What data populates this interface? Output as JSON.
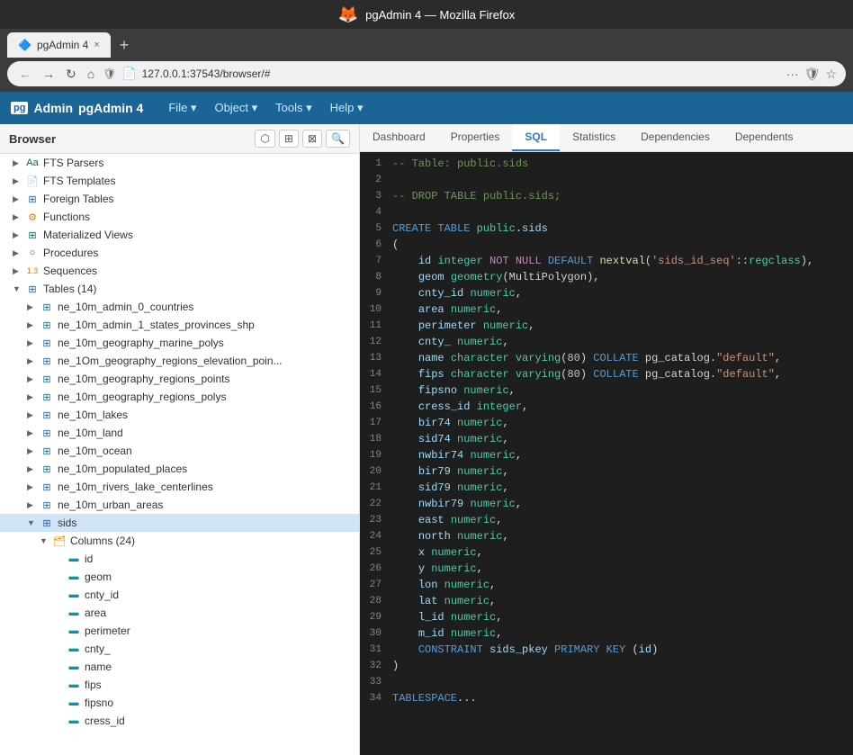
{
  "window": {
    "title": "pgAdmin 4 — Mozilla Firefox",
    "tab_label": "pgAdmin 4",
    "tab_close": "×",
    "tab_new": "+",
    "address": "127.0.0.1:37543/browser/#",
    "address_prefix": "🔒",
    "nav_back": "←",
    "nav_forward": "→",
    "nav_refresh": "↻",
    "nav_home": "⌂"
  },
  "pgadmin": {
    "logo_pg": "pg",
    "logo_admin": "Admin",
    "app_name": "pgAdmin 4",
    "menus": [
      {
        "label": "File ▾"
      },
      {
        "label": "Object ▾"
      },
      {
        "label": "Tools ▾"
      },
      {
        "label": "Help ▾"
      }
    ]
  },
  "browser": {
    "title": "Browser",
    "tools": [
      "⬡",
      "⊞",
      "⊠",
      "🔍"
    ]
  },
  "tree": {
    "items": [
      {
        "indent": 1,
        "arrow": "▶",
        "icon": "Aa",
        "icon_class": "icon-teal",
        "label": "FTS Parsers"
      },
      {
        "indent": 1,
        "arrow": "▶",
        "icon": "📄",
        "icon_class": "icon-orange",
        "label": "FTS Templates"
      },
      {
        "indent": 1,
        "arrow": "▶",
        "icon": "⊞",
        "icon_class": "icon-blue",
        "label": "Foreign Tables"
      },
      {
        "indent": 1,
        "arrow": "▶",
        "icon": "⚙",
        "icon_class": "icon-orange",
        "label": "Functions"
      },
      {
        "indent": 1,
        "arrow": "▶",
        "icon": "⊞",
        "icon_class": "icon-teal",
        "label": "Materialized Views"
      },
      {
        "indent": 1,
        "arrow": "▶",
        "icon": "○",
        "icon_class": "icon-purple",
        "label": "Procedures"
      },
      {
        "indent": 1,
        "arrow": "▶",
        "icon": "1.3",
        "icon_class": "icon-orange",
        "label": "Sequences"
      },
      {
        "indent": 1,
        "arrow": "▼",
        "icon": "⊞",
        "icon_class": "icon-blue",
        "label": "Tables (14)"
      },
      {
        "indent": 2,
        "arrow": "▶",
        "icon": "⊞",
        "icon_class": "icon-blue",
        "label": "ne_10m_admin_0_countries"
      },
      {
        "indent": 2,
        "arrow": "▶",
        "icon": "⊞",
        "icon_class": "icon-blue",
        "label": "ne_10m_admin_1_states_provinces_shp"
      },
      {
        "indent": 2,
        "arrow": "▶",
        "icon": "⊞",
        "icon_class": "icon-blue",
        "label": "ne_10m_geography_marine_polys"
      },
      {
        "indent": 2,
        "arrow": "▶",
        "icon": "⊞",
        "icon_class": "icon-blue",
        "label": "ne_10m_geography_regions_elevation_poin..."
      },
      {
        "indent": 2,
        "arrow": "▶",
        "icon": "⊞",
        "icon_class": "icon-blue",
        "label": "ne_10m_geography_regions_points"
      },
      {
        "indent": 2,
        "arrow": "▶",
        "icon": "⊞",
        "icon_class": "icon-blue",
        "label": "ne_10m_geography_regions_polys"
      },
      {
        "indent": 2,
        "arrow": "▶",
        "icon": "⊞",
        "icon_class": "icon-blue",
        "label": "ne_10m_lakes"
      },
      {
        "indent": 2,
        "arrow": "▶",
        "icon": "⊞",
        "icon_class": "icon-blue",
        "label": "ne_10m_land"
      },
      {
        "indent": 2,
        "arrow": "▶",
        "icon": "⊞",
        "icon_class": "icon-blue",
        "label": "ne_10m_ocean"
      },
      {
        "indent": 2,
        "arrow": "▶",
        "icon": "⊞",
        "icon_class": "icon-blue",
        "label": "ne_10m_populated_places"
      },
      {
        "indent": 2,
        "arrow": "▶",
        "icon": "⊞",
        "icon_class": "icon-blue",
        "label": "ne_10m_rivers_lake_centerlines"
      },
      {
        "indent": 2,
        "arrow": "▶",
        "icon": "⊞",
        "icon_class": "icon-blue",
        "label": "ne_10m_urban_areas"
      },
      {
        "indent": 2,
        "arrow": "▼",
        "icon": "⊞",
        "icon_class": "icon-blue",
        "label": "sids",
        "selected": true
      },
      {
        "indent": 3,
        "arrow": "▼",
        "icon": "🗂",
        "icon_class": "icon-orange",
        "label": "Columns (24)"
      },
      {
        "indent": 4,
        "arrow": "",
        "icon": "▬",
        "icon_class": "icon-cyan",
        "label": "id"
      },
      {
        "indent": 4,
        "arrow": "",
        "icon": "▬",
        "icon_class": "icon-cyan",
        "label": "geom"
      },
      {
        "indent": 4,
        "arrow": "",
        "icon": "▬",
        "icon_class": "icon-cyan",
        "label": "cnty_id"
      },
      {
        "indent": 4,
        "arrow": "",
        "icon": "▬",
        "icon_class": "icon-cyan",
        "label": "area"
      },
      {
        "indent": 4,
        "arrow": "",
        "icon": "▬",
        "icon_class": "icon-cyan",
        "label": "perimeter"
      },
      {
        "indent": 4,
        "arrow": "",
        "icon": "▬",
        "icon_class": "icon-cyan",
        "label": "cnty_"
      },
      {
        "indent": 4,
        "arrow": "",
        "icon": "▬",
        "icon_class": "icon-cyan",
        "label": "name"
      },
      {
        "indent": 4,
        "arrow": "",
        "icon": "▬",
        "icon_class": "icon-cyan",
        "label": "fips"
      },
      {
        "indent": 4,
        "arrow": "",
        "icon": "▬",
        "icon_class": "icon-cyan",
        "label": "fipsno"
      },
      {
        "indent": 4,
        "arrow": "",
        "icon": "▬",
        "icon_class": "icon-cyan",
        "label": "cress_id"
      }
    ]
  },
  "tabs": [
    {
      "label": "Dashboard"
    },
    {
      "label": "Properties"
    },
    {
      "label": "SQL",
      "active": true
    },
    {
      "label": "Statistics"
    },
    {
      "label": "Dependencies"
    },
    {
      "label": "Dependents"
    }
  ],
  "sql": {
    "lines": [
      {
        "num": 1,
        "code": "-- Table: public.sids",
        "type": "comment"
      },
      {
        "num": 2,
        "code": "",
        "type": "blank"
      },
      {
        "num": 3,
        "code": "-- DROP TABLE public.sids;",
        "type": "comment"
      },
      {
        "num": 4,
        "code": "",
        "type": "blank"
      },
      {
        "num": 5,
        "code": "CREATE TABLE public.sids",
        "type": "create_table"
      },
      {
        "num": 6,
        "code": "(",
        "type": "punc"
      },
      {
        "num": 7,
        "code": "    id integer NOT NULL DEFAULT nextval('sids_id_seq'::regclass),",
        "type": "col_def"
      },
      {
        "num": 8,
        "code": "    geom geometry(MultiPolygon),",
        "type": "col_def"
      },
      {
        "num": 9,
        "code": "    cnty_id numeric,",
        "type": "col_def"
      },
      {
        "num": 10,
        "code": "    area numeric,",
        "type": "col_def"
      },
      {
        "num": 11,
        "code": "    perimeter numeric,",
        "type": "col_def"
      },
      {
        "num": 12,
        "code": "    cnty_ numeric,",
        "type": "col_def"
      },
      {
        "num": 13,
        "code": "    name character varying(80) COLLATE pg_catalog.\"default\",",
        "type": "col_def"
      },
      {
        "num": 14,
        "code": "    fips character varying(80) COLLATE pg_catalog.\"default\",",
        "type": "col_def"
      },
      {
        "num": 15,
        "code": "    fipsno numeric,",
        "type": "col_def"
      },
      {
        "num": 16,
        "code": "    cress_id integer,",
        "type": "col_def"
      },
      {
        "num": 17,
        "code": "    bir74 numeric,",
        "type": "col_def"
      },
      {
        "num": 18,
        "code": "    sid74 numeric,",
        "type": "col_def"
      },
      {
        "num": 19,
        "code": "    nwbir74 numeric,",
        "type": "col_def"
      },
      {
        "num": 20,
        "code": "    bir79 numeric,",
        "type": "col_def"
      },
      {
        "num": 21,
        "code": "    sid79 numeric,",
        "type": "col_def"
      },
      {
        "num": 22,
        "code": "    nwbir79 numeric,",
        "type": "col_def"
      },
      {
        "num": 23,
        "code": "    east numeric,",
        "type": "col_def"
      },
      {
        "num": 24,
        "code": "    north numeric,",
        "type": "col_def"
      },
      {
        "num": 25,
        "code": "    x numeric,",
        "type": "col_def"
      },
      {
        "num": 26,
        "code": "    y numeric,",
        "type": "col_def"
      },
      {
        "num": 27,
        "code": "    lon numeric,",
        "type": "col_def"
      },
      {
        "num": 28,
        "code": "    lat numeric,",
        "type": "col_def"
      },
      {
        "num": 29,
        "code": "    l_id numeric,",
        "type": "col_def"
      },
      {
        "num": 30,
        "code": "    m_id numeric,",
        "type": "col_def"
      },
      {
        "num": 31,
        "code": "    CONSTRAINT sids_pkey PRIMARY KEY (id)",
        "type": "constraint"
      },
      {
        "num": 32,
        "code": ")",
        "type": "punc"
      },
      {
        "num": 33,
        "code": "",
        "type": "blank"
      },
      {
        "num": 34,
        "code": "TABLESPACE...",
        "type": "partial"
      }
    ]
  }
}
